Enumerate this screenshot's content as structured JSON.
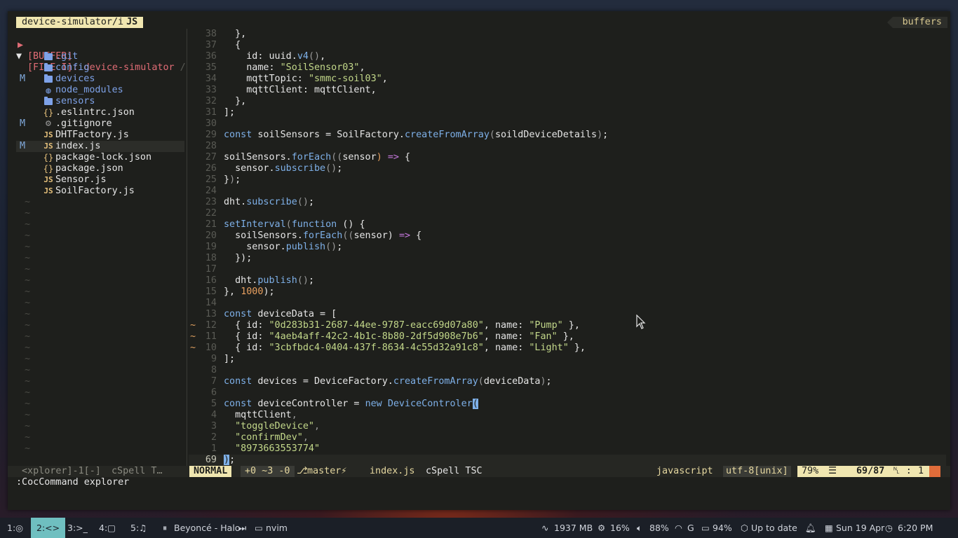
{
  "tabline": {
    "active_tab": "device-simulator/i",
    "active_tab_badge": "JS",
    "buffers_label": "buffers"
  },
  "explorer": {
    "buffer_label": "[BUFFER]",
    "file_label": "[FILE I]: device-simulator",
    "file_label_suffix": " /",
    "items": [
      {
        "git": "",
        "icon": "folder-icon",
        "name": ".git",
        "kind": "folder"
      },
      {
        "git": "",
        "icon": "folder-icon",
        "name": "config",
        "kind": "folder"
      },
      {
        "git": "M",
        "icon": "folder-icon",
        "name": "devices",
        "kind": "folder"
      },
      {
        "git": "",
        "icon": "node-modules-icon",
        "name": "node_modules",
        "kind": "folder"
      },
      {
        "git": "",
        "icon": "folder-icon",
        "name": "sensors",
        "kind": "folder"
      },
      {
        "git": "",
        "icon": "json-icon",
        "name": ".eslintrc.json",
        "kind": "file"
      },
      {
        "git": "M",
        "icon": "gear-icon",
        "name": ".gitignore",
        "kind": "file"
      },
      {
        "git": "",
        "icon": "js-icon",
        "name": "DHTFactory.js",
        "kind": "file"
      },
      {
        "git": "M",
        "icon": "js-icon",
        "name": "index.js",
        "kind": "file",
        "selected": true
      },
      {
        "git": "",
        "icon": "json-icon",
        "name": "package-lock.json",
        "kind": "file"
      },
      {
        "git": "",
        "icon": "json-icon",
        "name": "package.json",
        "kind": "file"
      },
      {
        "git": "",
        "icon": "js-icon",
        "name": "Sensor.js",
        "kind": "file"
      },
      {
        "git": "",
        "icon": "js-icon",
        "name": "SoilFactory.js",
        "kind": "file"
      }
    ],
    "tilde_rows": 23,
    "tilde": "~"
  },
  "editor": {
    "lines": [
      {
        "n": "38",
        "sign": "",
        "html": "  },"
      },
      {
        "n": "37",
        "sign": "",
        "html": "  {"
      },
      {
        "n": "36",
        "sign": "",
        "html": "    id: uuid.<span class=\"fn\">v4</span><span class=\"punc\">()</span>,"
      },
      {
        "n": "35",
        "sign": "",
        "html": "    name: <span class=\"str\">\"SoilSensor03\"</span>,"
      },
      {
        "n": "34",
        "sign": "",
        "html": "    mqttTopic: <span class=\"str\">\"smmc-soil03\"</span>,"
      },
      {
        "n": "33",
        "sign": "",
        "html": "    mqttClient: mqttClient,"
      },
      {
        "n": "32",
        "sign": "",
        "html": "  },"
      },
      {
        "n": "31",
        "sign": "",
        "html": "];"
      },
      {
        "n": "30",
        "sign": "",
        "html": ""
      },
      {
        "n": "29",
        "sign": "",
        "html": "<span class=\"kw\">const</span> soilSensors = SoilFactory.<span class=\"fn\">createFromArray</span><span class=\"punc\">(</span>soildDeviceDetails<span class=\"punc\">)</span>;"
      },
      {
        "n": "28",
        "sign": "",
        "html": ""
      },
      {
        "n": "27",
        "sign": "",
        "html": "soilSensors.<span class=\"fn\">forEach</span><span class=\"punc\">((</span>sensor<span class=\"num\">)</span> <span class=\"arrow\">=&gt;</span> {"
      },
      {
        "n": "26",
        "sign": "",
        "html": "  sensor.<span class=\"fn\">subscribe</span><span class=\"punc\">()</span>;"
      },
      {
        "n": "25",
        "sign": "",
        "html": "}<span class=\"punc\">)</span>;"
      },
      {
        "n": "24",
        "sign": "",
        "html": ""
      },
      {
        "n": "23",
        "sign": "",
        "html": "dht.<span class=\"fn\">subscribe</span><span class=\"punc\">()</span>;"
      },
      {
        "n": "22",
        "sign": "",
        "html": ""
      },
      {
        "n": "21",
        "sign": "",
        "html": "<span class=\"fn\">setInterval</span><span class=\"punc\">(</span><span class=\"kw\">function</span> () {"
      },
      {
        "n": "20",
        "sign": "",
        "html": "  soilSensors.<span class=\"fn\">forEach</span><span class=\"punc\">((</span>sensor) <span class=\"arrow\">=&gt;</span> {"
      },
      {
        "n": "19",
        "sign": "",
        "html": "    sensor.<span class=\"fn\">publish</span><span class=\"punc\">()</span>;"
      },
      {
        "n": "18",
        "sign": "",
        "html": "  });"
      },
      {
        "n": "17",
        "sign": "",
        "html": ""
      },
      {
        "n": "16",
        "sign": "",
        "html": "  dht.<span class=\"fn\">publish</span><span class=\"punc\">()</span>;"
      },
      {
        "n": "15",
        "sign": "",
        "html": "}, <span class=\"num\">1000</span>);"
      },
      {
        "n": "14",
        "sign": "",
        "html": ""
      },
      {
        "n": "13",
        "sign": "",
        "html": "<span class=\"kw\">const</span> deviceData = ["
      },
      {
        "n": "12",
        "sign": "~",
        "html": "  { id: <span class=\"str\">\"0d283b31-2687-44ee-9787-eacc69d07a80\"</span>, name: <span class=\"str\">\"Pump\"</span> },"
      },
      {
        "n": "11",
        "sign": "~",
        "html": "  { id: <span class=\"str\">\"4aeb4aff-42c2-4b1c-8b80-2df5d908e7b6\"</span>, name: <span class=\"str\">\"Fan\"</span> },"
      },
      {
        "n": "10",
        "sign": "~",
        "html": "  { id: <span class=\"str\">\"3cbfbdc4-0404-437f-8634-4c55d32a91c8\"</span>, name: <span class=\"str\">\"Light\"</span> },"
      },
      {
        "n": "9",
        "sign": "",
        "html": "];"
      },
      {
        "n": "8",
        "sign": "",
        "html": ""
      },
      {
        "n": "7",
        "sign": "",
        "html": "<span class=\"kw\">const</span> devices = DeviceFactory.<span class=\"fn\">createFromArray</span><span class=\"punc\">(</span>deviceData<span class=\"punc\">)</span>;"
      },
      {
        "n": "6",
        "sign": "",
        "html": ""
      },
      {
        "n": "5",
        "sign": "",
        "html": "<span class=\"kw\">const</span> deviceController = <span class=\"kw\">new</span> <span class=\"fn\">DeviceControler</span><span class=\"cursor\">(</span>"
      },
      {
        "n": "4",
        "sign": "",
        "html": "  mqttClient<span class=\"punc\">,</span>"
      },
      {
        "n": "3",
        "sign": "",
        "html": "  <span class=\"str\">\"toggleDevice\"</span><span class=\"punc\">,</span>"
      },
      {
        "n": "2",
        "sign": "",
        "html": "  <span class=\"str\">\"confirmDev\"</span><span class=\"punc\">,</span>"
      },
      {
        "n": "1",
        "sign": "",
        "html": "  <span class=\"str\">\"8973663553774\"</span>"
      },
      {
        "n": "69",
        "sign": "",
        "html": "<span class=\"cursor\">)</span>;",
        "current": true
      }
    ]
  },
  "statusline": {
    "explorer_name": "<xplorer]-1[-]",
    "explorer_ext": "cSpell T…",
    "mode": "NORMAL",
    "git_diff": "+0 ~3 -0",
    "branch": "master⚡",
    "filename": "index.js",
    "extensions": "cSpell TSC",
    "filetype": "javascript",
    "encoding": "utf-8[unix]",
    "percent": "79%",
    "position": "69/87",
    "column": "1"
  },
  "cmdline": ":CocCommand explorer",
  "taskbar": {
    "workspaces": [
      {
        "label": "1:",
        "icon": "firefox-icon",
        "active": false
      },
      {
        "label": "2:",
        "icon": "code-icon",
        "active": true
      },
      {
        "label": "3:",
        "icon": "terminal-icon",
        "active": false
      },
      {
        "label": "4:",
        "icon": "chat-icon",
        "active": false
      },
      {
        "label": "5:",
        "icon": "music-icon",
        "active": false
      }
    ],
    "media": "Beyoncé - Halo",
    "window": "nvim",
    "memory": "1937 MB",
    "cpu": "16%",
    "volume": "88%",
    "wifi": "G",
    "battery": "94%",
    "updates": "Up to date",
    "date": "Sun 19 Apr",
    "time": "6:20 PM"
  },
  "colors": {
    "mode_bg": "#f0e6b0",
    "accent": "#6fbfc0",
    "git_modified": "#7fa7d8",
    "string": "#c3d88a",
    "keyword": "#7eb0e8"
  }
}
